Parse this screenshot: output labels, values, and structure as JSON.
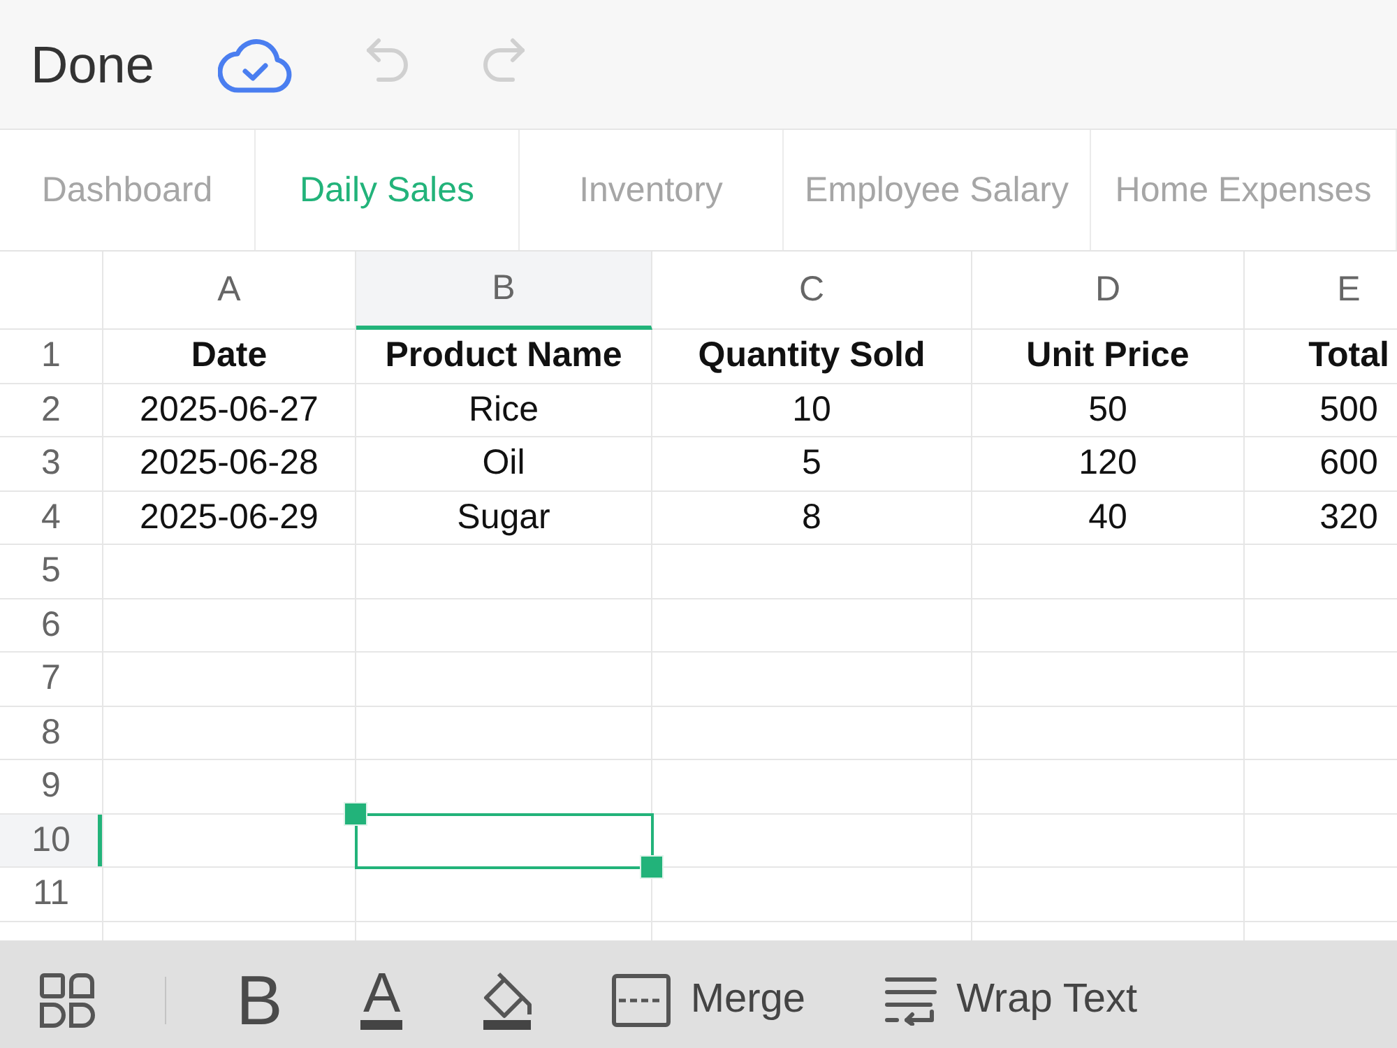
{
  "toolbar": {
    "done_label": "Done",
    "undo": {
      "disabled": true
    },
    "redo": {
      "disabled": true
    }
  },
  "sheet_tabs": [
    {
      "label": "Dashboard",
      "selected": false
    },
    {
      "label": "Daily Sales",
      "selected": true
    },
    {
      "label": "Inventory",
      "selected": false
    },
    {
      "label": "Employee Salary",
      "selected": false
    },
    {
      "label": "Home Expenses",
      "selected": false
    }
  ],
  "sheet": {
    "columns": [
      {
        "label": "A",
        "selected": false
      },
      {
        "label": "B",
        "selected": true
      },
      {
        "label": "C",
        "selected": false
      },
      {
        "label": "D",
        "selected": false
      },
      {
        "label": "E",
        "selected": false
      }
    ],
    "header_row": {
      "label": "1",
      "selected": false,
      "cells": [
        "Date",
        "Product Name",
        "Quantity Sold",
        "Unit Price",
        "Total"
      ]
    },
    "rows": [
      {
        "label": "2",
        "selected": false,
        "cells": [
          "2025-06-27",
          "Rice",
          "10",
          "50",
          "500"
        ]
      },
      {
        "label": "3",
        "selected": false,
        "cells": [
          "2025-06-28",
          "Oil",
          "5",
          "120",
          "600"
        ]
      },
      {
        "label": "4",
        "selected": false,
        "cells": [
          "2025-06-29",
          "Sugar",
          "8",
          "40",
          "320"
        ]
      },
      {
        "label": "5",
        "selected": false
      },
      {
        "label": "6",
        "selected": false
      },
      {
        "label": "7",
        "selected": false
      },
      {
        "label": "8",
        "selected": false
      },
      {
        "label": "9",
        "selected": false
      },
      {
        "label": "10",
        "selected": true
      },
      {
        "label": "11",
        "selected": false
      }
    ]
  },
  "format_bar": {
    "items": [
      {
        "kind": "panels"
      },
      {
        "kind": "bold",
        "label": "B"
      },
      {
        "kind": "font-color",
        "label": "A"
      },
      {
        "kind": "fill"
      },
      {
        "kind": "merge",
        "label": "Merge"
      },
      {
        "kind": "wrap",
        "label": "Wrap Text"
      }
    ]
  }
}
